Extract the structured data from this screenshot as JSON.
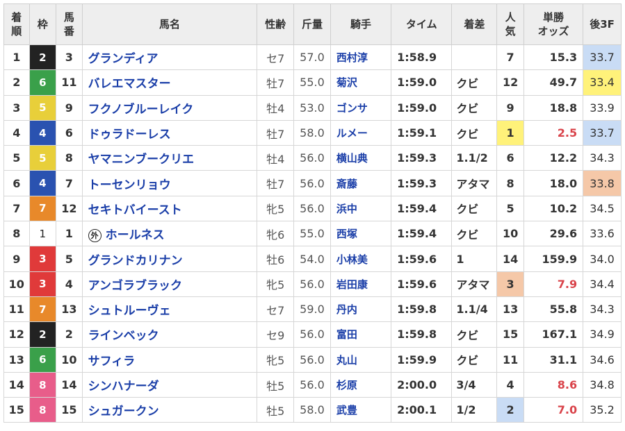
{
  "headers": {
    "rank_line1": "着",
    "rank_line2": "順",
    "waku": "枠",
    "uma_line1": "馬",
    "uma_line2": "番",
    "name": "馬名",
    "sex_age": "性齢",
    "kinryo": "斤量",
    "jockey": "騎手",
    "time": "タイム",
    "margin": "着差",
    "pop_line1": "人",
    "pop_line2": "気",
    "odds_line1": "単勝",
    "odds_line2": "オッズ",
    "last3f": "後3F"
  },
  "colors": {
    "waku_1": "#ffffff",
    "waku_2": "#222222",
    "waku_3": "#e03a3a",
    "waku_4": "#2a52b0",
    "waku_5": "#e8cf3a",
    "waku_6": "#3aa04a",
    "waku_7": "#e8892a",
    "waku_8": "#e85d8a",
    "pop_1_bg": "#fff27a",
    "pop_2_bg": "#c9dcf5",
    "pop_3_bg": "#f5c8a8",
    "odds_fav": "#d9434a",
    "last3f_1": "#c9dcf5",
    "last3f_2": "#fff27a",
    "last3f_3": "#f5c8a8",
    "name_link": "#1a3ea8"
  },
  "gaikoku_mark": "外",
  "rows": [
    {
      "rank": "1",
      "waku": "2",
      "uma": "3",
      "name": "グランディア",
      "gaikoku": false,
      "sex": "セ7",
      "kin": "57.0",
      "jockey": "西村淳",
      "time": "1:58.9",
      "margin": "",
      "pop": "7",
      "odds": "15.3",
      "last": "33.7",
      "pop_hl": "",
      "last_hl": "1",
      "odds_red": false
    },
    {
      "rank": "2",
      "waku": "6",
      "uma": "11",
      "name": "バレエマスター",
      "gaikoku": false,
      "sex": "牡7",
      "kin": "55.0",
      "jockey": "菊沢",
      "time": "1:59.0",
      "margin": "クビ",
      "pop": "12",
      "odds": "49.7",
      "last": "33.4",
      "pop_hl": "",
      "last_hl": "2",
      "odds_red": false
    },
    {
      "rank": "3",
      "waku": "5",
      "uma": "9",
      "name": "フクノブルーレイク",
      "gaikoku": false,
      "sex": "牡4",
      "kin": "53.0",
      "jockey": "ゴンサ",
      "time": "1:59.0",
      "margin": "クビ",
      "pop": "9",
      "odds": "18.8",
      "last": "33.9",
      "pop_hl": "",
      "last_hl": "",
      "odds_red": false
    },
    {
      "rank": "4",
      "waku": "4",
      "uma": "6",
      "name": "ドゥラドーレス",
      "gaikoku": false,
      "sex": "牡7",
      "kin": "58.0",
      "jockey": "ルメー",
      "time": "1:59.1",
      "margin": "クビ",
      "pop": "1",
      "odds": "2.5",
      "last": "33.7",
      "pop_hl": "1",
      "last_hl": "1",
      "odds_red": true
    },
    {
      "rank": "5",
      "waku": "5",
      "uma": "8",
      "name": "ヤマニンブークリエ",
      "gaikoku": false,
      "sex": "牡4",
      "kin": "56.0",
      "jockey": "横山典",
      "time": "1:59.3",
      "margin": "1.1/2",
      "pop": "6",
      "odds": "12.2",
      "last": "34.3",
      "pop_hl": "",
      "last_hl": "",
      "odds_red": false
    },
    {
      "rank": "6",
      "waku": "4",
      "uma": "7",
      "name": "トーセンリョウ",
      "gaikoku": false,
      "sex": "牡7",
      "kin": "56.0",
      "jockey": "斎藤",
      "time": "1:59.3",
      "margin": "アタマ",
      "pop": "8",
      "odds": "18.0",
      "last": "33.8",
      "pop_hl": "",
      "last_hl": "3",
      "odds_red": false
    },
    {
      "rank": "7",
      "waku": "7",
      "uma": "12",
      "name": "セキトバイースト",
      "gaikoku": false,
      "sex": "牝5",
      "kin": "56.0",
      "jockey": "浜中",
      "time": "1:59.4",
      "margin": "クビ",
      "pop": "5",
      "odds": "10.2",
      "last": "34.5",
      "pop_hl": "",
      "last_hl": "",
      "odds_red": false
    },
    {
      "rank": "8",
      "waku": "1",
      "uma": "1",
      "name": "ホールネス",
      "gaikoku": true,
      "sex": "牝6",
      "kin": "55.0",
      "jockey": "西塚",
      "time": "1:59.4",
      "margin": "クビ",
      "pop": "10",
      "odds": "29.6",
      "last": "33.6",
      "pop_hl": "",
      "last_hl": "",
      "odds_red": false
    },
    {
      "rank": "9",
      "waku": "3",
      "uma": "5",
      "name": "グランドカリナン",
      "gaikoku": false,
      "sex": "牡6",
      "kin": "54.0",
      "jockey": "小林美",
      "time": "1:59.6",
      "margin": "1",
      "pop": "14",
      "odds": "159.9",
      "last": "34.0",
      "pop_hl": "",
      "last_hl": "",
      "odds_red": false
    },
    {
      "rank": "10",
      "waku": "3",
      "uma": "4",
      "name": "アンゴラブラック",
      "gaikoku": false,
      "sex": "牝5",
      "kin": "56.0",
      "jockey": "岩田康",
      "time": "1:59.6",
      "margin": "アタマ",
      "pop": "3",
      "odds": "7.9",
      "last": "34.4",
      "pop_hl": "3",
      "last_hl": "",
      "odds_red": true
    },
    {
      "rank": "11",
      "waku": "7",
      "uma": "13",
      "name": "シュトルーヴェ",
      "gaikoku": false,
      "sex": "セ7",
      "kin": "59.0",
      "jockey": "丹内",
      "time": "1:59.8",
      "margin": "1.1/4",
      "pop": "13",
      "odds": "55.8",
      "last": "34.3",
      "pop_hl": "",
      "last_hl": "",
      "odds_red": false
    },
    {
      "rank": "12",
      "waku": "2",
      "uma": "2",
      "name": "ラインベック",
      "gaikoku": false,
      "sex": "セ9",
      "kin": "56.0",
      "jockey": "富田",
      "time": "1:59.8",
      "margin": "クビ",
      "pop": "15",
      "odds": "167.1",
      "last": "34.9",
      "pop_hl": "",
      "last_hl": "",
      "odds_red": false
    },
    {
      "rank": "13",
      "waku": "6",
      "uma": "10",
      "name": "サフィラ",
      "gaikoku": false,
      "sex": "牝5",
      "kin": "56.0",
      "jockey": "丸山",
      "time": "1:59.9",
      "margin": "クビ",
      "pop": "11",
      "odds": "31.1",
      "last": "34.6",
      "pop_hl": "",
      "last_hl": "",
      "odds_red": false
    },
    {
      "rank": "14",
      "waku": "8",
      "uma": "14",
      "name": "シンハナーダ",
      "gaikoku": false,
      "sex": "牡5",
      "kin": "56.0",
      "jockey": "杉原",
      "time": "2:00.0",
      "margin": "3/4",
      "pop": "4",
      "odds": "8.6",
      "last": "34.8",
      "pop_hl": "",
      "last_hl": "",
      "odds_red": true
    },
    {
      "rank": "15",
      "waku": "8",
      "uma": "15",
      "name": "シュガークン",
      "gaikoku": false,
      "sex": "牡5",
      "kin": "58.0",
      "jockey": "武豊",
      "time": "2:00.1",
      "margin": "1/2",
      "pop": "2",
      "odds": "7.0",
      "last": "35.2",
      "pop_hl": "2",
      "last_hl": "",
      "odds_red": true
    }
  ]
}
